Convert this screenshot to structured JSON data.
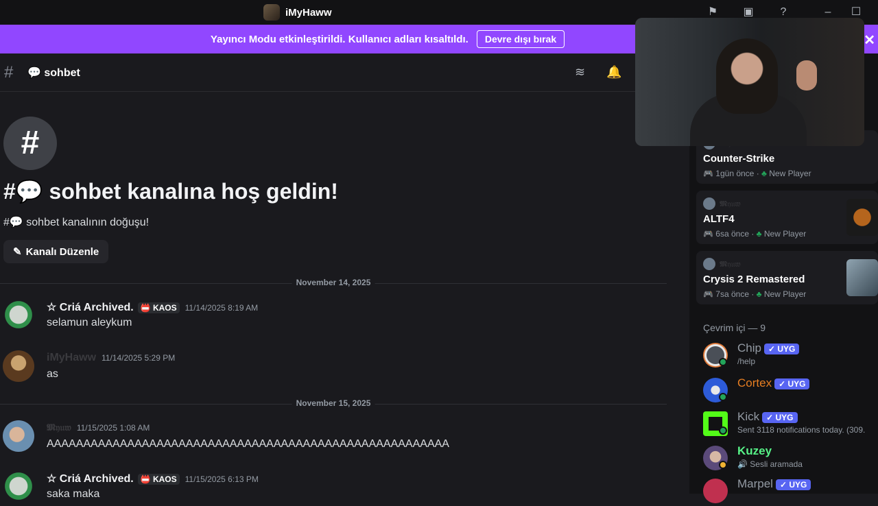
{
  "window": {
    "title": "iMyHaww"
  },
  "banner": {
    "text": "Yayıncı Modu etkinleştirildi. Kullanıcı adları kısaltıldı.",
    "button": "Devre dışı bırak",
    "close": "✕"
  },
  "header": {
    "hash": "#",
    "channel": "💬 sohbet"
  },
  "intro": {
    "hash": "#",
    "welcome": "#💬 sohbet kanalına hoş geldin!",
    "birth": "#💬 sohbet kanalının doğuşu!",
    "edit_button": "Kanalı Düzenle"
  },
  "dividers": [
    "November 14, 2025",
    "November 15, 2025"
  ],
  "messages": [
    {
      "author": "☆ Criá Archived.",
      "tag": "📛 KAOS",
      "time": "11/14/2025 8:19 AM",
      "text": "selamun aleykum"
    },
    {
      "author": "iMyHaww",
      "time": "11/14/2025 5:29 PM",
      "text": "as"
    },
    {
      "author": "𝕸𝔶𝔲𝔴",
      "time": "11/15/2025 1:08 AM",
      "text": "AAAAAAAAAAAAAAAAAAAAAAAAAAAAAAAAAAAAAAAAAAAAAAAAAAAAAAA"
    },
    {
      "author": "☆ Criá Archived.",
      "tag": "📛 KAOS",
      "time": "11/15/2025 6:13 PM",
      "text": "saka maka"
    }
  ],
  "activities": [
    {
      "user": "𝕸𝔶𝔲𝔴",
      "game": "Counter-Strike",
      "ago": "1gün önce",
      "badge": "New Player"
    },
    {
      "user": "𝕸𝔶𝔲𝔴",
      "game": "ALTF4",
      "ago": "6sa önce",
      "badge": "New Player"
    },
    {
      "user": "𝕸𝔶𝔲𝔴",
      "game": "Crysis 2 Remastered",
      "ago": "7sa önce",
      "badge": "New Player"
    }
  ],
  "members_section": "Çevrim içi — 9",
  "members": [
    {
      "name": "Chip",
      "badge": "✓ UYG",
      "sub": "/help",
      "color": "#949ba4"
    },
    {
      "name": "Cortex",
      "badge": "✓ UYG",
      "sub": "",
      "color": "#e67e22"
    },
    {
      "name": "Kick",
      "badge": "✓ UYG",
      "sub": "Sent 3118 notifications today. (309.",
      "color": "#949ba4"
    },
    {
      "name": "Kuzey",
      "badge": "",
      "sub": "🔊 Sesli aramada",
      "color": "#57f287"
    },
    {
      "name": "Marpel",
      "badge": "✓ UYG",
      "sub": "",
      "color": "#949ba4"
    }
  ]
}
